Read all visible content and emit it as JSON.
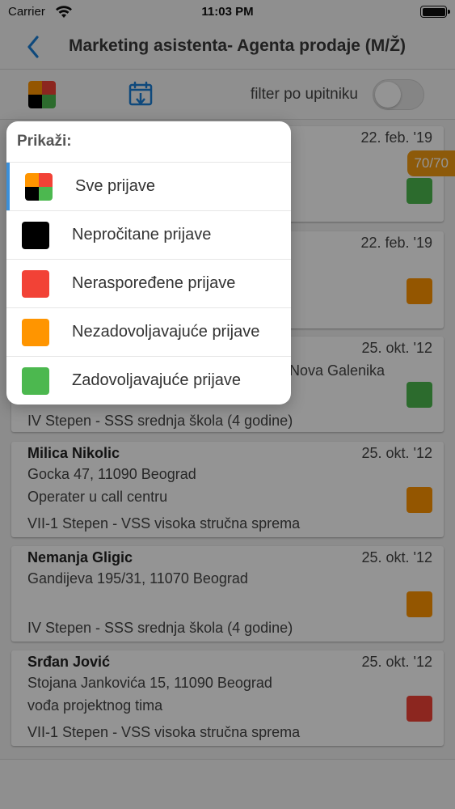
{
  "status_bar": {
    "carrier": "Carrier",
    "time": "11:03 PM"
  },
  "nav": {
    "title": "Marketing asistenta- Agenta prodaje (M/Ž)"
  },
  "toolbar": {
    "filter_label": "filter po upitniku",
    "filter_on": false
  },
  "colors": {
    "black": "#000000",
    "red": "#f24236",
    "orange": "#ff9500",
    "green": "#4cb84f",
    "accent": "#1a7fd6",
    "badge": "#f39c12"
  },
  "badge": {
    "text": "70/70"
  },
  "cards": [
    {
      "name": "",
      "date": "22. feb. '19",
      "lines": [
        "",
        "",
        ""
      ],
      "status": "green"
    },
    {
      "name": "",
      "date": "22. feb. '19",
      "lines": [
        "",
        "",
        ""
      ],
      "status": "orange"
    },
    {
      "name": "",
      "date": "25. okt. '12",
      "lines": [
        "Nova Galenika",
        "IV Stepen - SSS srednja škola (4 godine)"
      ],
      "status": "green"
    },
    {
      "name": "Milica Nikolic",
      "date": "25. okt. '12",
      "lines": [
        "Gocka 47, 11090 Beograd",
        "Operater u call centru",
        "VII-1 Stepen - VSS visoka stručna sprema"
      ],
      "status": "orange"
    },
    {
      "name": "Nemanja Gligic",
      "date": "25. okt. '12",
      "lines": [
        "Gandijeva 195/31, 11070 Beograd",
        "",
        "IV Stepen - SSS srednja škola (4 godine)"
      ],
      "status": "orange"
    },
    {
      "name": "Srđan Jović",
      "date": "25. okt. '12",
      "lines": [
        "Stojana Jankovića 15, 11090 Beograd",
        "vođa projektnog tima",
        "VII-1 Stepen - VSS visoka stručna sprema"
      ],
      "status": "red"
    }
  ],
  "popup": {
    "title": "Prikaži:",
    "options": [
      {
        "label": "Sve prijave",
        "icon": "multicolor-grid-icon",
        "selected": true
      },
      {
        "label": "Nepročitane prijave",
        "icon": "black-square-icon",
        "selected": false
      },
      {
        "label": "Neraspoređene prijave",
        "icon": "red-square-icon",
        "selected": false
      },
      {
        "label": "Nezadovoljavajuće prijave",
        "icon": "orange-square-icon",
        "selected": false
      },
      {
        "label": "Zadovoljavajuće prijave",
        "icon": "green-square-icon",
        "selected": false
      }
    ]
  }
}
